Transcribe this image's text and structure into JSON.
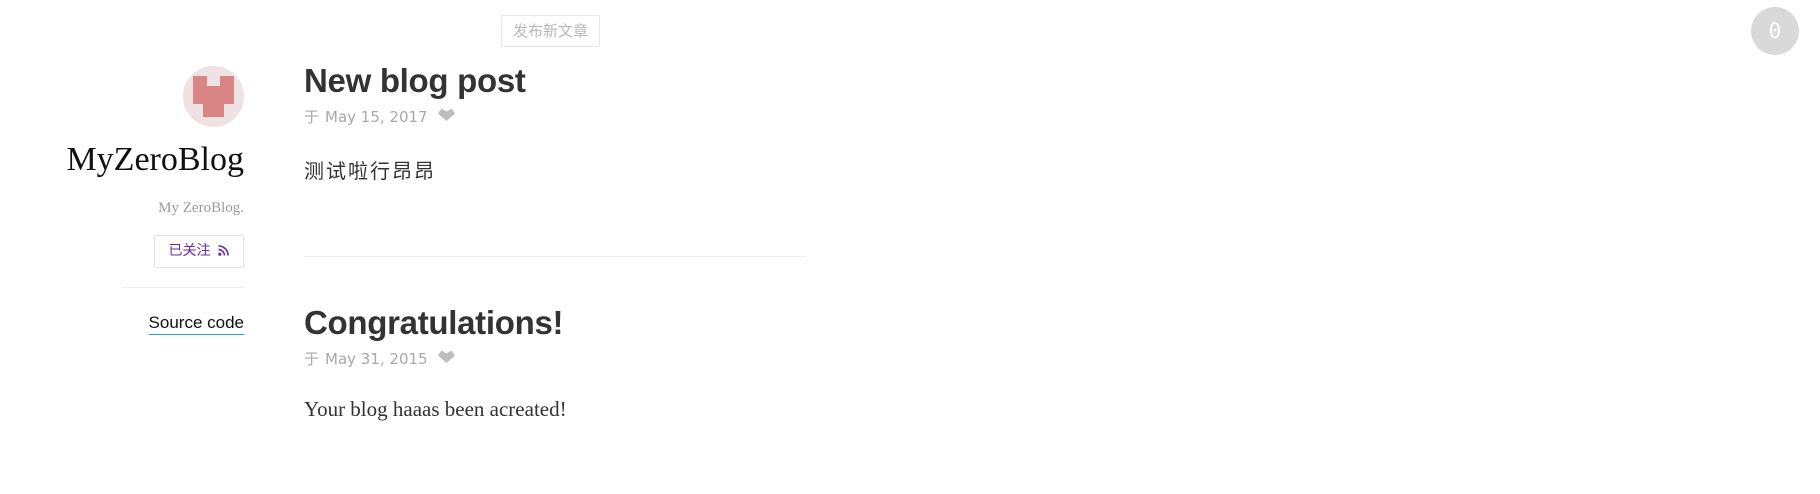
{
  "toolbar": {
    "new_post_label": "发布新文章",
    "counter_value": "0"
  },
  "sidebar": {
    "site_title": "MyZeroBlog",
    "site_description": "My ZeroBlog.",
    "follow_label": "已关注",
    "source_code_label": "Source code"
  },
  "posts": [
    {
      "title": "New blog post",
      "date_prefix": "于",
      "date": "May 15, 2017",
      "body": "测试啦行昂昂"
    },
    {
      "title": "Congratulations!",
      "date_prefix": "于",
      "date": "May 31, 2015",
      "body": "Your blog haaas been acreated!"
    }
  ],
  "colors": {
    "accent_follow": "#6a2ca0",
    "link_underline": "#2e9bd6",
    "avatar_pink": "#d98585"
  },
  "icons": [
    "avatar-identicon",
    "rss-icon",
    "heart-icon"
  ]
}
